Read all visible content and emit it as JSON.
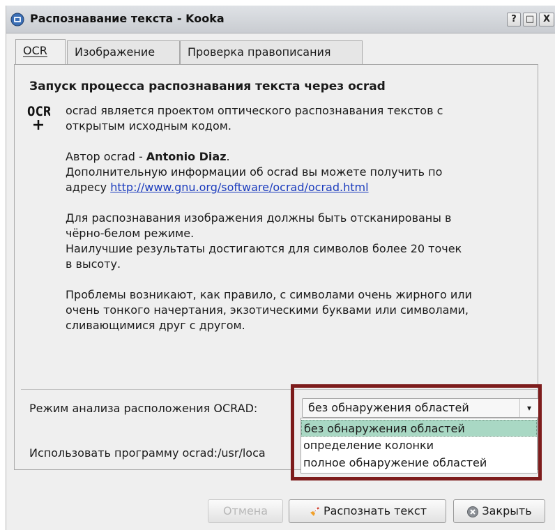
{
  "window": {
    "title": "Распознавание текста - Kooka"
  },
  "titlebar_buttons": {
    "help": "?",
    "maximize": "□",
    "close": "X"
  },
  "tabs": [
    {
      "label": "OCR"
    },
    {
      "label": "Изображение"
    },
    {
      "label": "Проверка правописания"
    }
  ],
  "content": {
    "heading": "Запуск процесса распознавания текста через ocrad",
    "icon_text": "OCR",
    "intro_line1": "ocrad является проектом оптического распознавания текстов с",
    "intro_line2": "открытым исходным кодом.",
    "author_prefix": "Автор ocrad - ",
    "author_name": "Antonio Diaz",
    "author_suffix": ".",
    "info_line1": "Дополнительную информации об ocrad вы можете получить по",
    "info_prefix": "адресу ",
    "info_url": "http://www.gnu.org/software/ocrad/ocrad.html",
    "scan_line1": "Для распознавания изображения должны быть отсканированы в",
    "scan_line2": "чёрно-белом режиме.",
    "scan_line3": "Наилучшие результаты достигаются для символов более 20 точек",
    "scan_line4": "в высоту.",
    "prob_line1": "Проблемы возникают, как правило, с символами очень жирного или",
    "prob_line2": "очень тонкого начертания, экзотическими буквами или символами,",
    "prob_line3": "сливающимися друг с другом."
  },
  "layout_mode": {
    "label": "Режим анализа расположения OCRAD:",
    "selected": "без обнаружения областей",
    "options": [
      "без обнаружения областей",
      "определение колонки",
      "полное обнаружение областей"
    ]
  },
  "program": {
    "label": "Использовать программу ocrad:/usr/loca"
  },
  "buttons": {
    "cancel": "Отмена",
    "recognize": "Распознать текст",
    "close": "Закрыть"
  },
  "colors": {
    "highlight": "#7d1c1c",
    "selected_option": "#a9d8c4",
    "link": "#1a3bbd"
  }
}
